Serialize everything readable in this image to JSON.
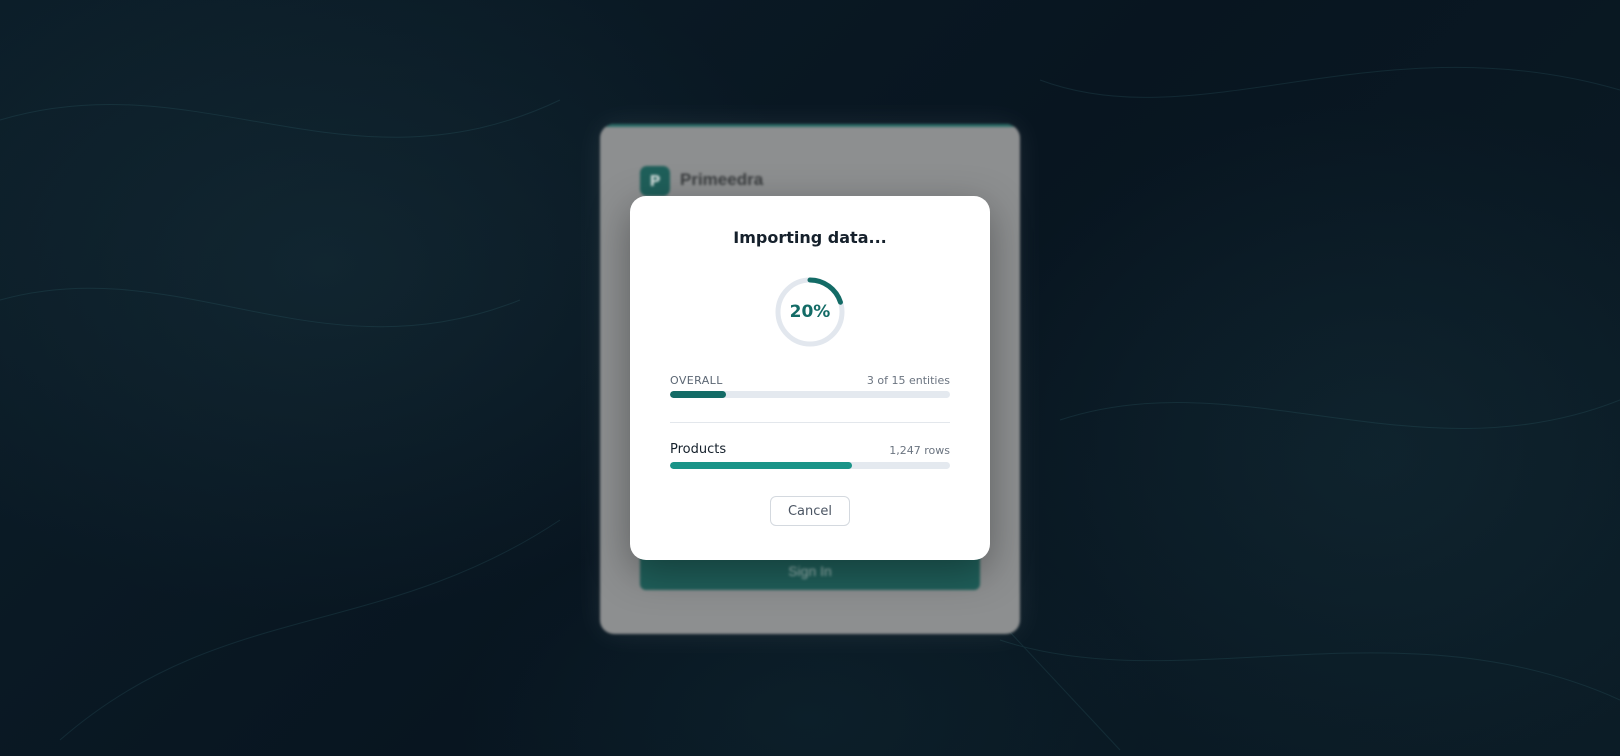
{
  "background_login": {
    "brand_initial": "P",
    "brand_name": "Primeedra",
    "signin_label": "Sign In"
  },
  "import_modal": {
    "title": "Importing data...",
    "percent_label": "20%",
    "percent_value": 20,
    "overall": {
      "label": "OVERALL",
      "count_text": "3 of 15 entities",
      "progress": 0.2
    },
    "current_entity": {
      "name": "Products",
      "rows_text": "1,247 rows",
      "progress": 0.65
    },
    "cancel_label": "Cancel"
  },
  "colors": {
    "accent": "#136b66",
    "accent_light": "#1a9488",
    "track": "#e4e9ef",
    "ring_track": "#e2e7ee"
  }
}
